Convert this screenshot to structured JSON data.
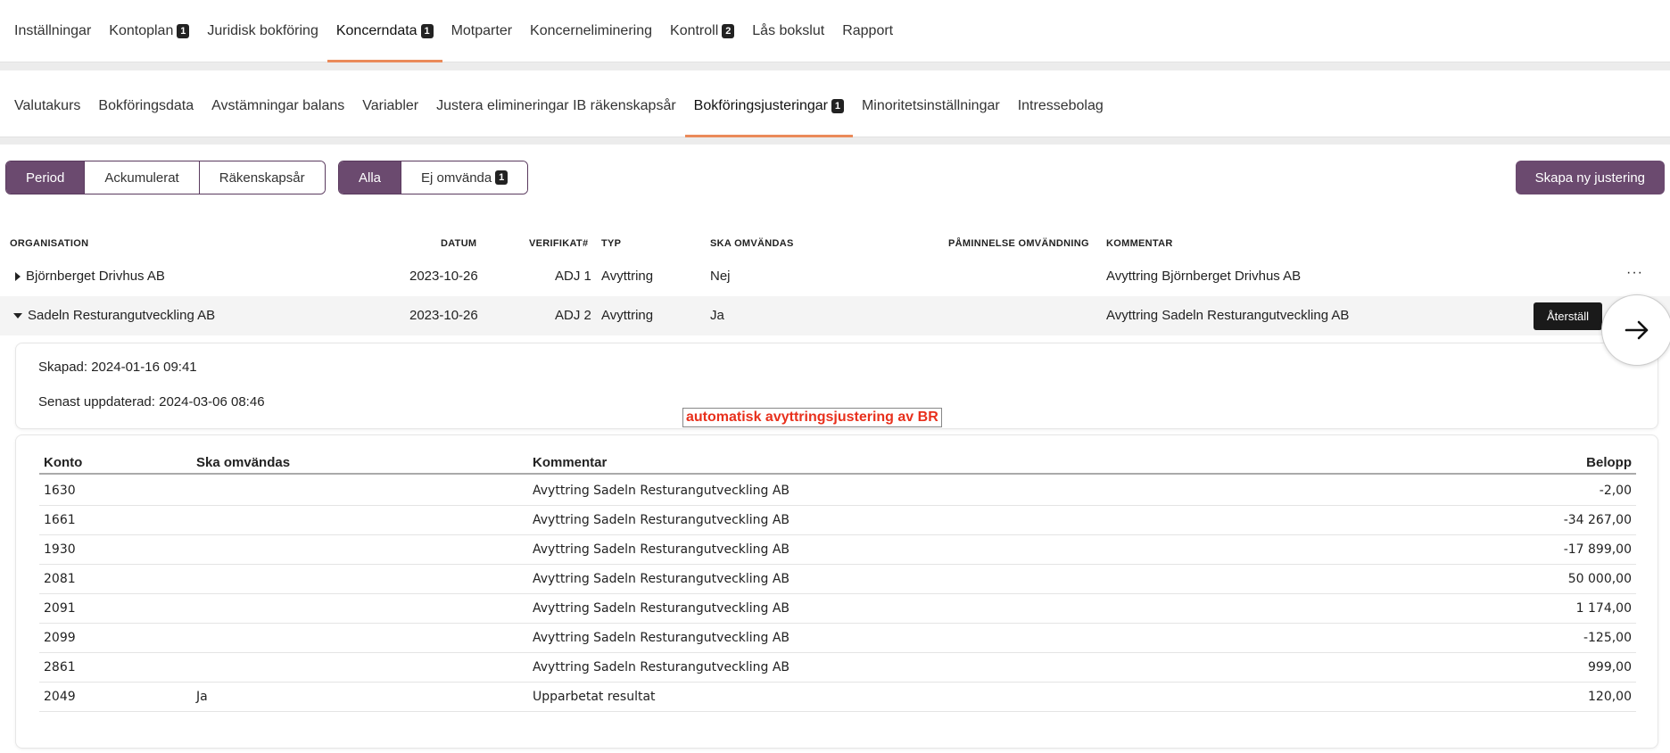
{
  "topnav": [
    {
      "label": "Inställningar"
    },
    {
      "label": "Kontoplan",
      "badge": "1"
    },
    {
      "label": "Juridisk bokföring"
    },
    {
      "label": "Koncerndata",
      "badge": "1",
      "active": true
    },
    {
      "label": "Motparter"
    },
    {
      "label": "Koncerneliminering"
    },
    {
      "label": "Kontroll",
      "badge": "2"
    },
    {
      "label": "Lås bokslut"
    },
    {
      "label": "Rapport"
    }
  ],
  "subnav": [
    {
      "label": "Valutakurs"
    },
    {
      "label": "Bokföringsdata"
    },
    {
      "label": "Avstämningar balans"
    },
    {
      "label": "Variabler"
    },
    {
      "label": "Justera elimineringar IB räkenskapsår"
    },
    {
      "label": "Bokföringsjusteringar",
      "badge": "1",
      "active": true
    },
    {
      "label": "Minoritetsinställningar"
    },
    {
      "label": "Intressebolag"
    }
  ],
  "period_toggle": {
    "period": "Period",
    "ackumulerat": "Ackumulerat",
    "rakenskapsar": "Räkenskapsår",
    "selected": "Period"
  },
  "filter_toggle": {
    "alla": "Alla",
    "ej_omvanda": "Ej omvända",
    "ej_omvanda_badge": "1",
    "selected": "Alla"
  },
  "create_button": "Skapa ny justering",
  "table": {
    "headers": {
      "organisation": "ORGANISATION",
      "datum": "DATUM",
      "verifikat": "VERIFIKAT#",
      "typ": "TYP",
      "ska_omvandas": "SKA OMVÄNDAS",
      "paminnelse": "PÅMINNELSE OMVÄNDNING",
      "kommentar": "KOMMENTAR"
    },
    "rows": [
      {
        "organisation": "Björnberget Drivhus AB",
        "datum": "2023-10-26",
        "verifikat": "ADJ 1",
        "typ": "Avyttring",
        "ska_omvandas": "Nej",
        "paminnelse": "",
        "kommentar": "Avyttring Björnberget Drivhus AB",
        "more": "···"
      },
      {
        "organisation": "Sadeln Resturangutveckling AB",
        "datum": "2023-10-26",
        "verifikat": "ADJ 2",
        "typ": "Avyttring",
        "ska_omvandas": "Ja",
        "paminnelse": "",
        "kommentar": "Avyttring Sadeln Resturangutveckling AB",
        "action": "Återställ"
      }
    ]
  },
  "detail": {
    "skapad": "Skapad: 2024-01-16 09:41",
    "uppdaterad": "Senast uppdaterad: 2024-03-06 08:46",
    "annotation": "automatisk avyttringsjustering av BR"
  },
  "lines": {
    "headers": {
      "konto": "Konto",
      "ska_omvandas": "Ska omvändas",
      "kommentar": "Kommentar",
      "belopp": "Belopp"
    },
    "rows": [
      {
        "konto": "1630",
        "ska_omvandas": "",
        "kommentar": "Avyttring Sadeln Resturangutveckling AB",
        "belopp": "-2,00"
      },
      {
        "konto": "1661",
        "ska_omvandas": "",
        "kommentar": "Avyttring Sadeln Resturangutveckling AB",
        "belopp": "-34 267,00"
      },
      {
        "konto": "1930",
        "ska_omvandas": "",
        "kommentar": "Avyttring Sadeln Resturangutveckling AB",
        "belopp": "-17 899,00"
      },
      {
        "konto": "2081",
        "ska_omvandas": "",
        "kommentar": "Avyttring Sadeln Resturangutveckling AB",
        "belopp": "50 000,00"
      },
      {
        "konto": "2091",
        "ska_omvandas": "",
        "kommentar": "Avyttring Sadeln Resturangutveckling AB",
        "belopp": "1 174,00"
      },
      {
        "konto": "2099",
        "ska_omvandas": "",
        "kommentar": "Avyttring Sadeln Resturangutveckling AB",
        "belopp": "-125,00"
      },
      {
        "konto": "2861",
        "ska_omvandas": "",
        "kommentar": "Avyttring Sadeln Resturangutveckling AB",
        "belopp": "999,00"
      },
      {
        "konto": "2049",
        "ska_omvandas": "Ja",
        "kommentar": "Upparbetat resultat",
        "belopp": "120,00"
      }
    ]
  },
  "icons": {
    "next": "arrow-right-icon",
    "expand": "caret-right-icon",
    "collapse": "caret-down-icon"
  },
  "colors": {
    "accent": "#6b4a6f",
    "active_tab_underline": "#ea8a5a",
    "annotation": "#e8301c"
  }
}
